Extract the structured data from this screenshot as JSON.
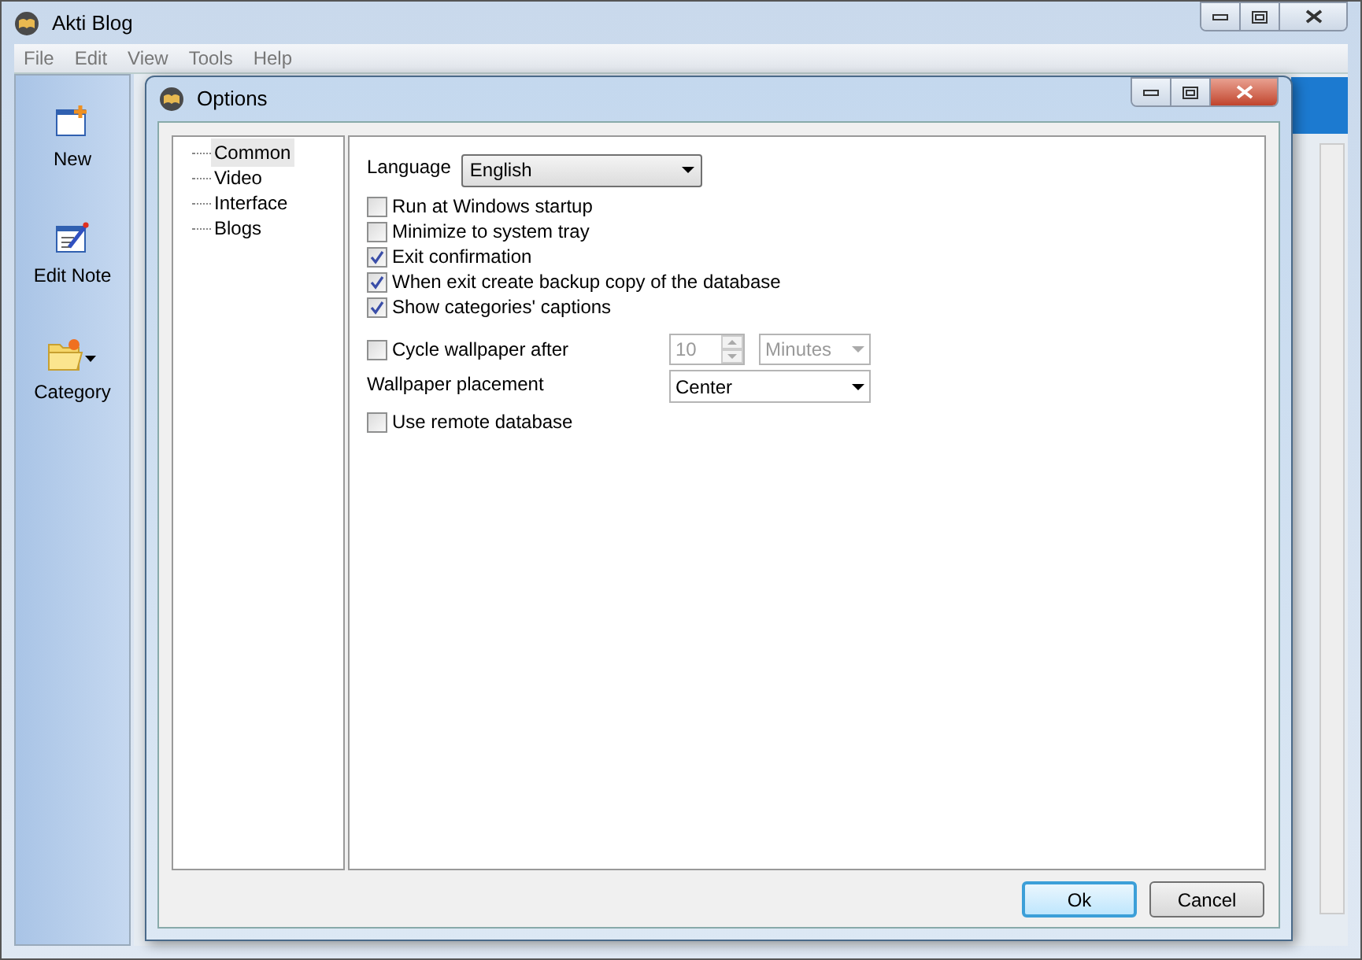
{
  "window": {
    "title": "Akti Blog"
  },
  "menu": [
    "File",
    "Edit",
    "View",
    "Tools",
    "Help"
  ],
  "toolbar": [
    {
      "label": "New",
      "kind": "new"
    },
    {
      "label": "Edit Note",
      "kind": "edit"
    },
    {
      "label": "Category",
      "kind": "category"
    }
  ],
  "dialog": {
    "title": "Options",
    "tree": [
      {
        "label": "Common",
        "selected": true
      },
      {
        "label": "Video",
        "selected": false
      },
      {
        "label": "Interface",
        "selected": false
      },
      {
        "label": "Blogs",
        "selected": false
      }
    ],
    "language": {
      "label": "Language",
      "value": "English"
    },
    "checkboxes": [
      {
        "label": "Run at Windows startup",
        "checked": false
      },
      {
        "label": "Minimize to system tray",
        "checked": false
      },
      {
        "label": "Exit confirmation",
        "checked": true
      },
      {
        "label": "When exit create backup copy of the database",
        "checked": true
      },
      {
        "label": "Show categories' captions",
        "checked": true
      }
    ],
    "cycle": {
      "label": "Cycle wallpaper after",
      "checked": false,
      "value": "10",
      "unit": "Minutes",
      "disabled": true
    },
    "placement": {
      "label": "Wallpaper placement",
      "value": "Center"
    },
    "remote": {
      "label": "Use remote database",
      "checked": false
    },
    "buttons": [
      {
        "label": "Ok",
        "kind": "default"
      },
      {
        "label": "Cancel",
        "kind": "normal"
      }
    ]
  }
}
